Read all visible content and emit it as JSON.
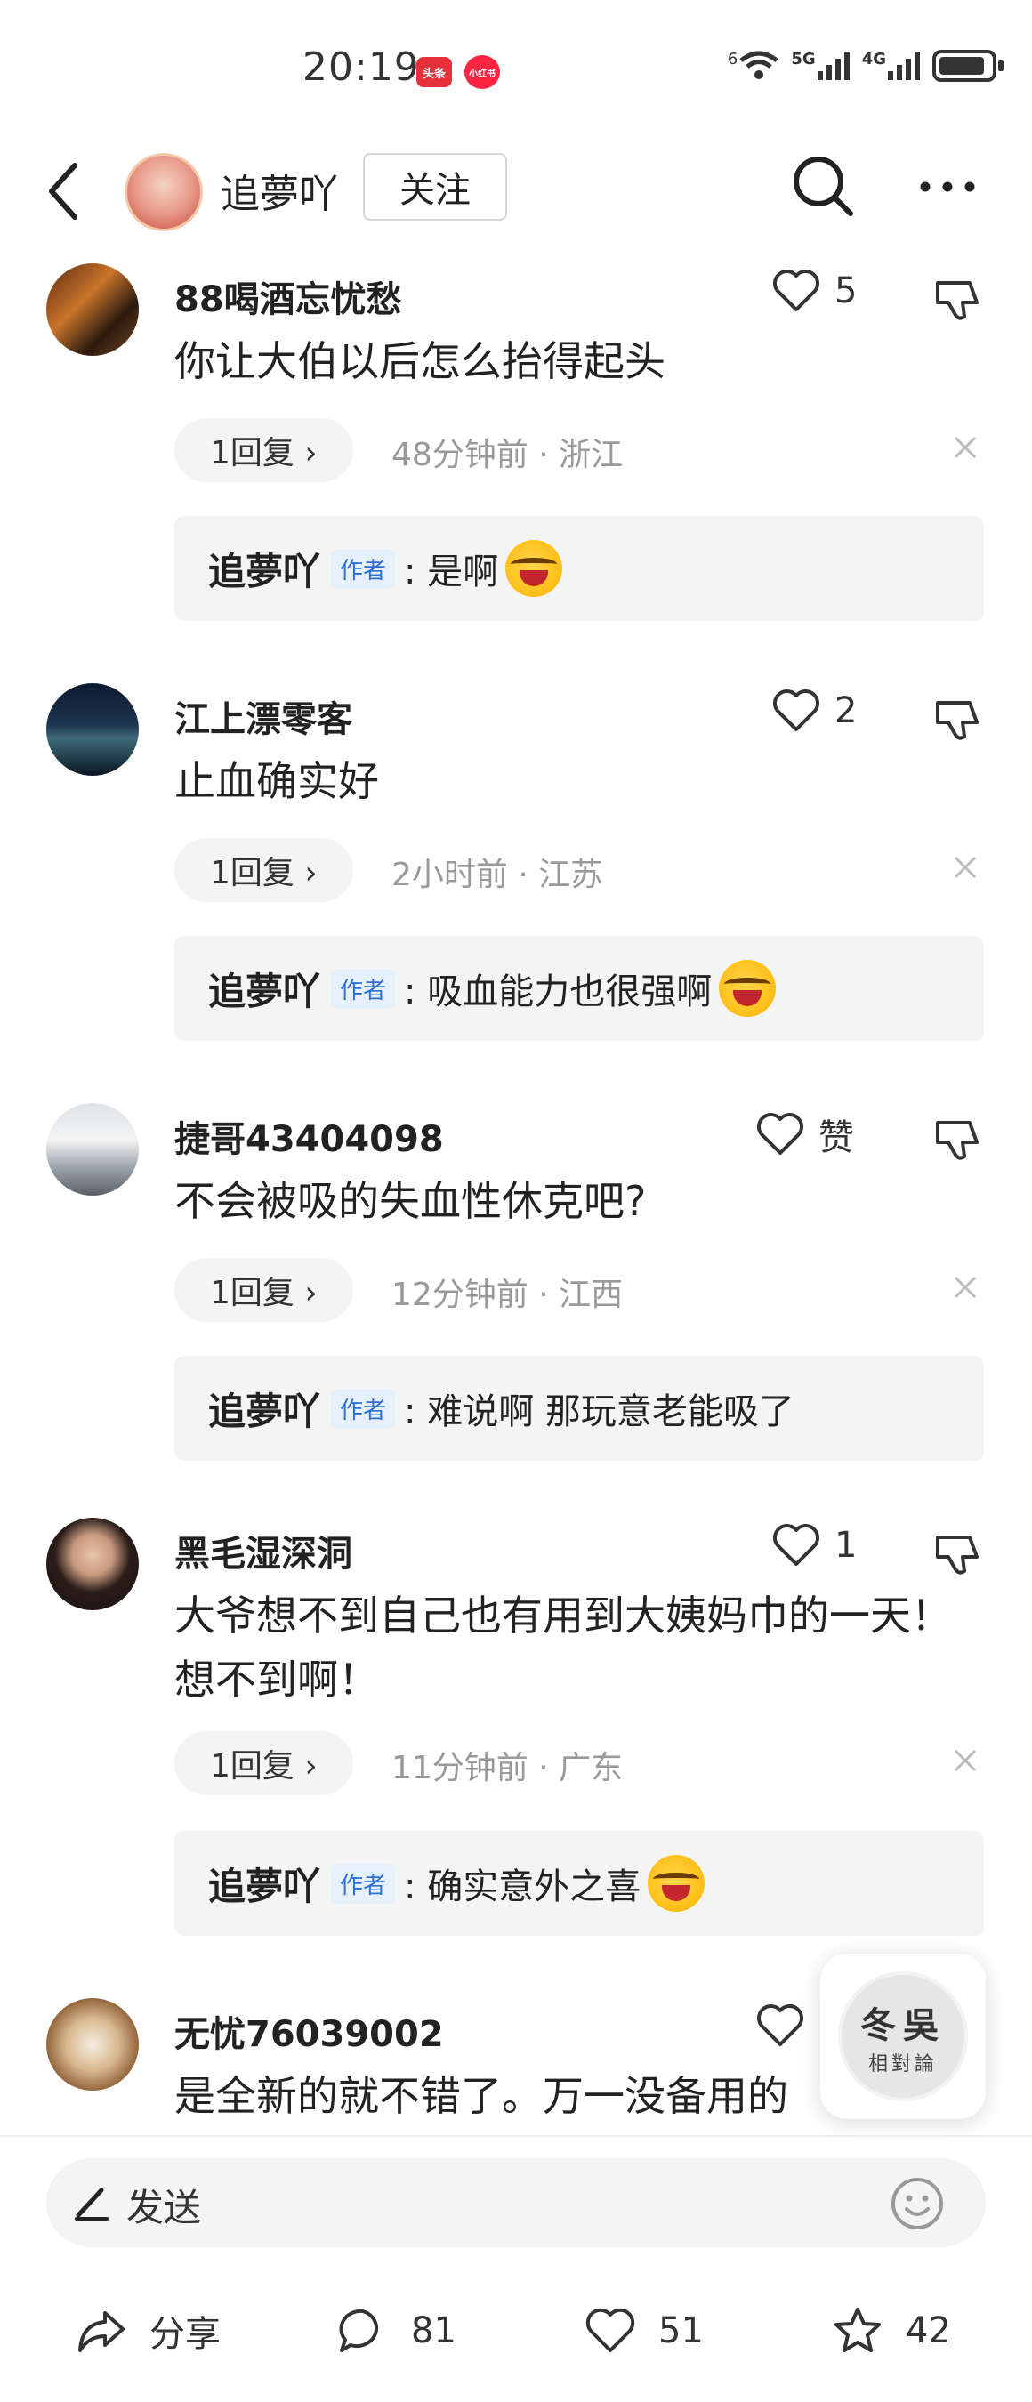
{
  "status_bar": {
    "time": "20:19",
    "badge_1": "头条",
    "badge_2": "小红书",
    "signal_1": "6",
    "signal_2": "5G",
    "signal_3": "4G"
  },
  "header": {
    "name": "追夢吖",
    "follow_label": "关注"
  },
  "comments": [
    {
      "name": "88喝酒忘忧愁",
      "like_count": "5",
      "text": "你让大伯以后怎么抬得起头",
      "reply_chip": "1回复 ›",
      "meta": "48分钟前 · 浙江",
      "reply_author": "追夢吖",
      "author_tag": "作者",
      "reply_text": ": 是啊"
    },
    {
      "name": "江上漂零客",
      "like_count": "2",
      "text": "止血确实好",
      "reply_chip": "1回复 ›",
      "meta": "2小时前 · 江苏",
      "reply_author": "追夢吖",
      "author_tag": "作者",
      "reply_text": ": 吸血能力也很强啊"
    },
    {
      "name": "捷哥43404098",
      "like_count": "赞",
      "text": "不会被吸的失血性休克吧?",
      "reply_chip": "1回复 ›",
      "meta": "12分钟前 · 江西",
      "reply_author": "追夢吖",
      "author_tag": "作者",
      "reply_text": ": 难说啊 那玩意老能吸了"
    },
    {
      "name": "黑毛湿深洞",
      "like_count": "1",
      "text": "大爷想不到自己也有用到大姨妈巾的一天！想不到啊！",
      "reply_chip": "1回复 ›",
      "meta": "11分钟前 · 广东",
      "reply_author": "追夢吖",
      "author_tag": "作者",
      "reply_text": ": 确实意外之喜"
    },
    {
      "name": "无忧76039002",
      "text": "是全新的就不错了。万一没备用的"
    }
  ],
  "float_widget": {
    "line_1": "冬吳",
    "line_2": "相對論"
  },
  "input_bar": {
    "placeholder": "发送"
  },
  "actions": {
    "share_label": "分享",
    "comment_count": "81",
    "like_count": "51",
    "favorite_count": "42"
  }
}
